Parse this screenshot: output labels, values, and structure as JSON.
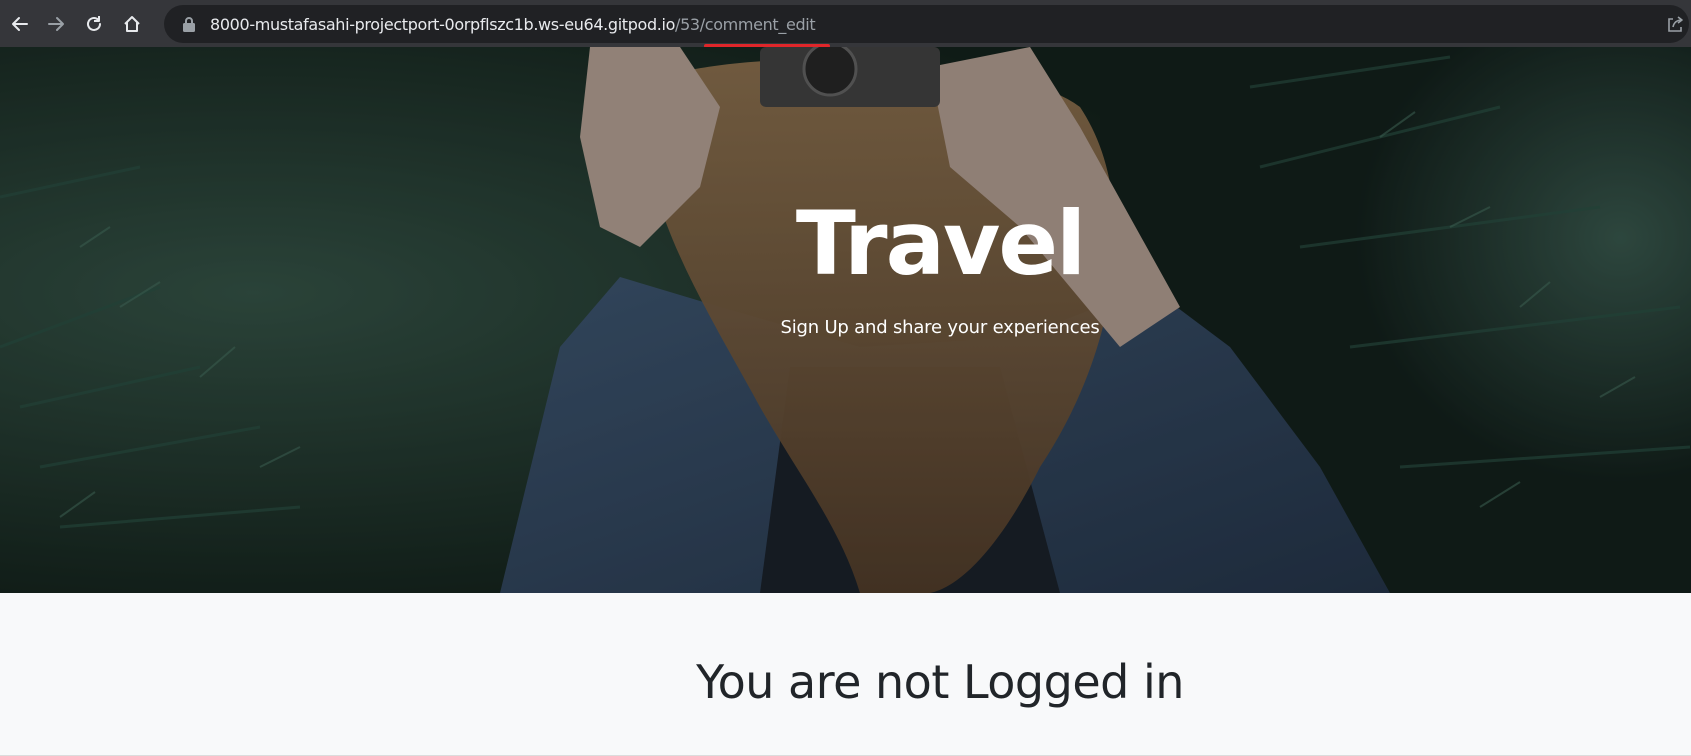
{
  "browser": {
    "url_host": "8000-mustafasahi-projectport-0orpflszc1b.ws-eu64.gitpod.io",
    "url_path": "/53/comment_edit",
    "icons": [
      "back-arrow-icon",
      "forward-arrow-icon",
      "reload-icon",
      "home-icon",
      "lock-icon",
      "share-icon"
    ],
    "highlight_color": "#e0262a"
  },
  "hero": {
    "title": "Travel",
    "subtitle": "Sign Up and share your experiences"
  },
  "main": {
    "message": "You are not Logged in"
  },
  "colors": {
    "toolbar_bg": "#35363a",
    "omnibox_bg": "#202124",
    "content_bg": "#f8f9fa",
    "text_dark": "#212529"
  }
}
